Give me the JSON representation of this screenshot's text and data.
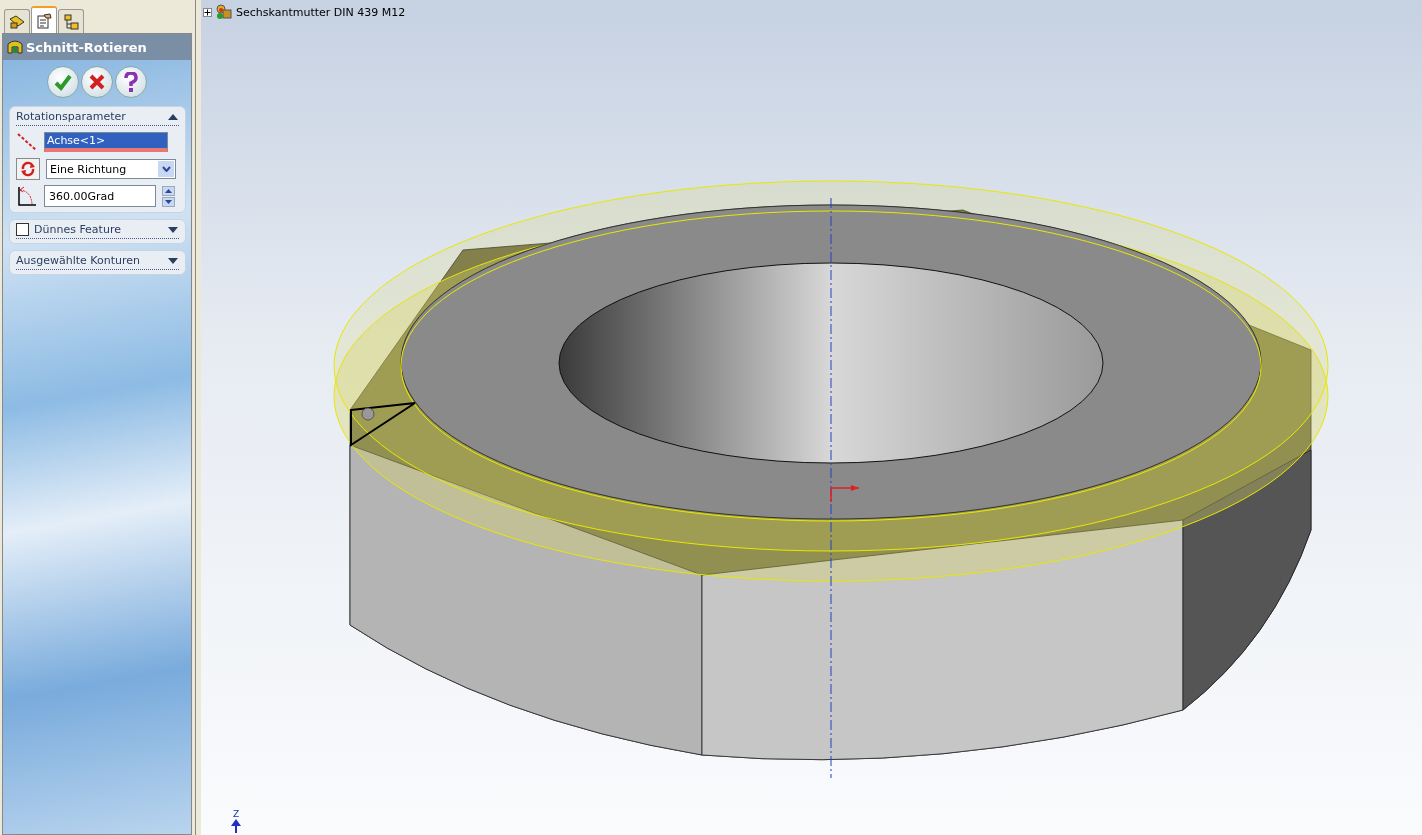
{
  "tabs": [
    {
      "kind": "feature-tree",
      "selected": false
    },
    {
      "kind": "properties",
      "selected": true
    },
    {
      "kind": "configurations",
      "selected": false
    }
  ],
  "panel": {
    "title": "Schnitt-Rotieren"
  },
  "rotation": {
    "title": "Rotationsparameter",
    "expanded": true,
    "axis": {
      "value": "Achse<1>",
      "selected": true
    },
    "direction": {
      "value": "Eine Richtung"
    },
    "angle": {
      "value": "360.00Grad"
    }
  },
  "sections": [
    {
      "kind": "checkbox",
      "title": "Dünnes Feature",
      "checked": false,
      "expanded": false
    },
    {
      "kind": "plain",
      "title": "Ausgewählte Konturen",
      "expanded": false
    }
  ],
  "viewport": {
    "tree_item": {
      "label": "Sechskantmutter DIN 439 M12",
      "expanded": false
    },
    "triad_label": "Z"
  }
}
